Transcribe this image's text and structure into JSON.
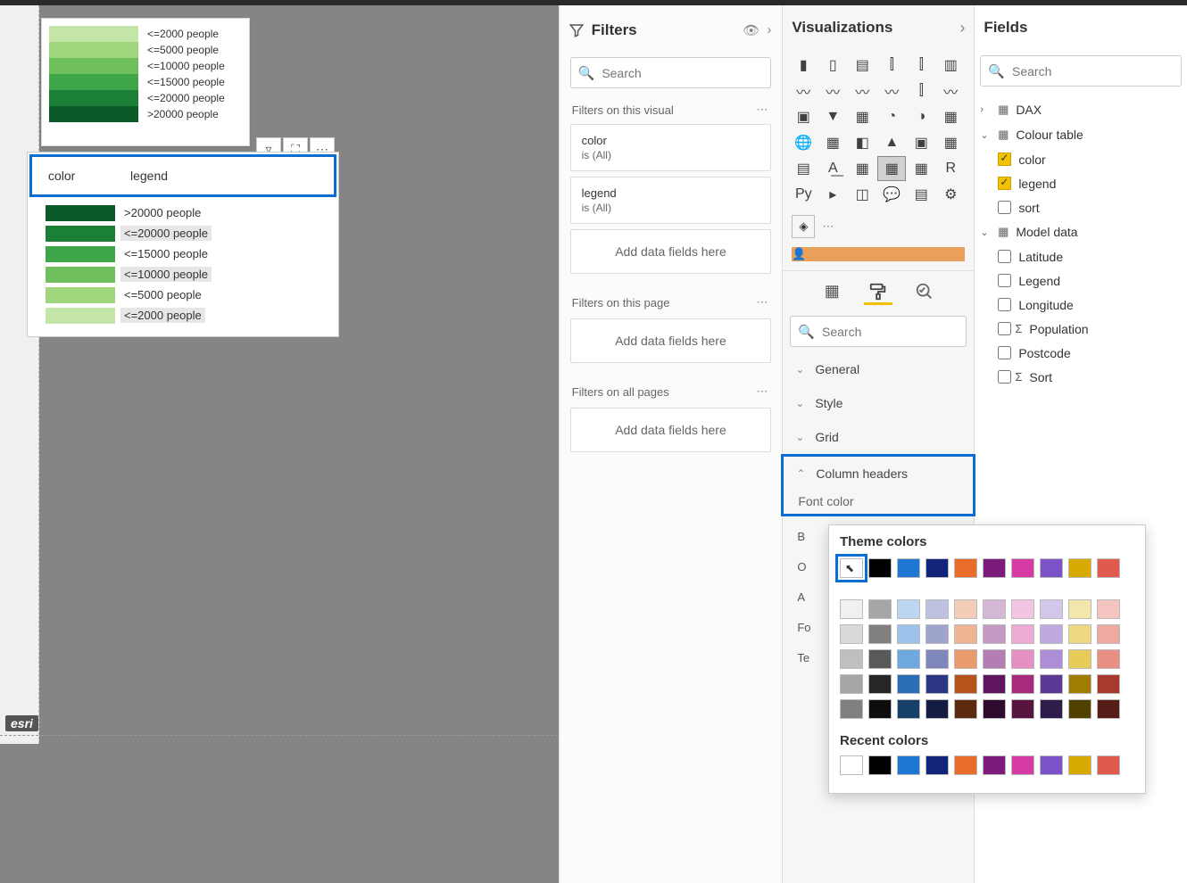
{
  "canvas": {
    "esri": "esri",
    "legend_card": [
      {
        "color": "#c4e6a8",
        "label": "<=2000 people"
      },
      {
        "color": "#9fd67d",
        "label": "<=5000 people"
      },
      {
        "color": "#6fbf5d",
        "label": "<=10000 people"
      },
      {
        "color": "#3ea648",
        "label": "<=15000 people"
      },
      {
        "color": "#1b8036",
        "label": "<=20000 people"
      },
      {
        "color": "#0b5a27",
        "label": ">20000 people"
      }
    ],
    "table": {
      "headers": {
        "col1": "color",
        "col2": "legend"
      },
      "rows": [
        {
          "color": "#0b5a27",
          "legend": ">20000 people",
          "sel": false
        },
        {
          "color": "#1b8036",
          "legend": "<=20000 people",
          "sel": true
        },
        {
          "color": "#3ea648",
          "legend": "<=15000 people",
          "sel": false
        },
        {
          "color": "#6fbf5d",
          "legend": "<=10000 people",
          "sel": true
        },
        {
          "color": "#9fd67d",
          "legend": "<=5000 people",
          "sel": false
        },
        {
          "color": "#c4e6a8",
          "legend": "<=2000 people",
          "sel": true
        }
      ]
    }
  },
  "filters": {
    "title": "Filters",
    "search_placeholder": "Search",
    "section_visual": "Filters on this visual",
    "cards": [
      {
        "name": "color",
        "cond": "is (All)"
      },
      {
        "name": "legend",
        "cond": "is (All)"
      }
    ],
    "add_fields": "Add data fields here",
    "section_page": "Filters on this page",
    "section_all": "Filters on all pages"
  },
  "viz": {
    "title": "Visualizations",
    "search_placeholder": "Search",
    "format_sections": {
      "general": "General",
      "style": "Style",
      "grid": "Grid",
      "column_headers": "Column headers",
      "font_color": "Font color"
    },
    "partial_left": {
      "b": "B",
      "o": "O",
      "a": "A",
      "f": "Fo",
      "t": "Te"
    }
  },
  "color_picker": {
    "theme_title": "Theme colors",
    "recent_title": "Recent colors",
    "theme_row": [
      "#ffffff",
      "#000000",
      "#1f77d4",
      "#11247a",
      "#e86c2a",
      "#7b1c7b",
      "#d63aa3",
      "#7b52c7",
      "#d8a900",
      "#e05a4e"
    ],
    "shades": [
      [
        "#f0f0f0",
        "#a6a6a6",
        "#bcd6f2",
        "#bec1e0",
        "#f4cdb9",
        "#d4b7d4",
        "#f2c6e3",
        "#d2c6ea",
        "#f3e6ab",
        "#f4c5c0"
      ],
      [
        "#d9d9d9",
        "#808080",
        "#9ec3ea",
        "#9fa4cd",
        "#efb494",
        "#c49ac4",
        "#ecabd3",
        "#bfaae0",
        "#eed982",
        "#eeaaa1"
      ],
      [
        "#bfbfbf",
        "#595959",
        "#6fa8df",
        "#7f86ba",
        "#e99a6e",
        "#b47db4",
        "#e58fc3",
        "#ab8ed6",
        "#e8cc59",
        "#e88f83"
      ],
      [
        "#a6a6a6",
        "#262626",
        "#2a6fb8",
        "#2b3785",
        "#b5531d",
        "#5e145e",
        "#a82a7c",
        "#5b3a95",
        "#a07d00",
        "#a8392f"
      ],
      [
        "#808080",
        "#0d0d0d",
        "#163f6a",
        "#151c44",
        "#5c2a0e",
        "#2f0a2f",
        "#56143f",
        "#2e1d4b",
        "#514000",
        "#561d18"
      ]
    ],
    "recent_row": [
      "#ffffff",
      "#000000",
      "#1f77d4",
      "#11247a",
      "#e86c2a",
      "#7b1c7b",
      "#d63aa3",
      "#7b52c7",
      "#d8a900",
      "#e05a4e"
    ]
  },
  "fields": {
    "title": "Fields",
    "search_placeholder": "Search",
    "tables": [
      {
        "name": "DAX",
        "expanded": false,
        "cols": []
      },
      {
        "name": "Colour table",
        "expanded": true,
        "marked": true,
        "cols": [
          {
            "name": "color",
            "checked": true
          },
          {
            "name": "legend",
            "checked": true
          },
          {
            "name": "sort",
            "checked": false
          }
        ]
      },
      {
        "name": "Model data",
        "expanded": true,
        "cols": [
          {
            "name": "Latitude",
            "checked": false
          },
          {
            "name": "Legend",
            "checked": false
          },
          {
            "name": "Longitude",
            "checked": false
          },
          {
            "name": "Population",
            "checked": false,
            "sigma": true
          },
          {
            "name": "Postcode",
            "checked": false
          },
          {
            "name": "Sort",
            "checked": false,
            "sigma": true
          }
        ]
      }
    ]
  }
}
